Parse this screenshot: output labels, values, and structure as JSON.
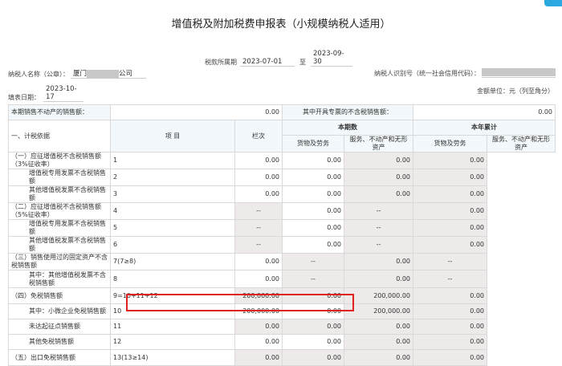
{
  "title": "增值税及附加税费申报表（小规模纳税人适用）",
  "period": {
    "label": "税款所属期",
    "from": "2023-07-01",
    "to_label": "至",
    "to": "2023-09-30"
  },
  "taxpayer_name": {
    "label": "纳税人名称（公章）：",
    "prefix": "厦门",
    "suffix": "公司"
  },
  "taxpayer_id": {
    "label": "纳税人识别号（统一社会信用代码）："
  },
  "fill_date": {
    "label": "填表日期：",
    "value": "2023-10-17"
  },
  "unit": "金额单位：元（列至角分）",
  "top_row": {
    "label1": "本期销售不动产的销售额：",
    "value1": "0.00",
    "label2": "其中开具专票的不含税销售额：",
    "value2": "0.00"
  },
  "headers": {
    "item": "项 目",
    "col_no": "栏次",
    "current": "本期数",
    "ytd": "本年累计",
    "goods": "货物及劳务",
    "services": "服务、不动产和无形资产"
  },
  "section": "一、计税依据",
  "rows": [
    {
      "item": "（一）应征增值税不含税销售额（3%征收率）",
      "no": "1",
      "c": [
        "0.00",
        "0.00",
        "0.00",
        "0.00"
      ]
    },
    {
      "item": "增值税专用发票不含税销售额",
      "no": "2",
      "c": [
        "0.00",
        "0.00",
        "0.00",
        "0.00"
      ]
    },
    {
      "item": "其他增值税发票不含税销售额",
      "no": "3",
      "c": [
        "0.00",
        "0.00",
        "0.00",
        "0.00"
      ]
    },
    {
      "item": "（二）应征增值税不含税销售额（5%征收率）",
      "no": "4",
      "c": [
        "--",
        "0.00",
        "--",
        "0.00"
      ]
    },
    {
      "item": "增值税专用发票不含税销售额",
      "no": "5",
      "c": [
        "--",
        "0.00",
        "--",
        "0.00"
      ]
    },
    {
      "item": "其他增值税发票不含税销售额",
      "no": "6",
      "c": [
        "--",
        "0.00",
        "--",
        "0.00"
      ]
    },
    {
      "item": "（三）销售使用过的固定资产不含税销售额",
      "no": "7(7≥8)",
      "c": [
        "0.00",
        "--",
        "0.00",
        "--"
      ]
    },
    {
      "item": "其中：其他增值税发票不含税销售额",
      "no": "8",
      "c": [
        "0.00",
        "--",
        "0.00",
        "--"
      ]
    },
    {
      "item": "（四）免税销售额",
      "no": "9=10+11+12",
      "c": [
        "200,000.00",
        "0.00",
        "200,000.00",
        "0.00"
      ]
    },
    {
      "item": "其中：小微企业免税销售额",
      "no": "10",
      "c": [
        "200,000.00",
        "0.00",
        "200,000.00",
        "0.00"
      ]
    },
    {
      "item": "未达起征点销售额",
      "no": "11",
      "c": [
        "0.00",
        "0.00",
        "0.00",
        "0.00"
      ]
    },
    {
      "item": "其他免税销售额",
      "no": "12",
      "c": [
        "0.00",
        "0.00",
        "0.00",
        "0.00"
      ]
    },
    {
      "item": "（五）出口免税销售额",
      "no": "13(13≥14)",
      "c": [
        "0.00",
        "0.00",
        "0.00",
        "0.00"
      ]
    }
  ],
  "colors": {
    "highlight": "#e02020",
    "readonly": "#eeeaea",
    "header": "#f2f8fb"
  }
}
